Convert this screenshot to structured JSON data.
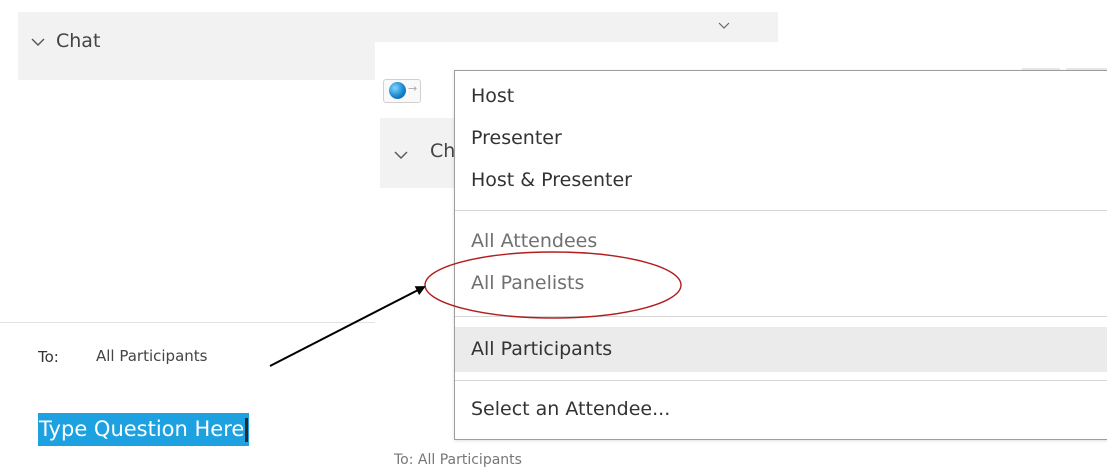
{
  "background_panel": {
    "chat_title": "Chat",
    "to_label": "To:",
    "to_value": "All Participants",
    "question_text": "Type Question Here"
  },
  "overlay_panel": {
    "chat_title_partial": "Ch",
    "bottom_text_partial": "To:   All Participants"
  },
  "dropdown": {
    "groups": [
      [
        "Host",
        "Presenter",
        "Host & Presenter"
      ],
      [
        "All Attendees",
        "All Panelists"
      ],
      [
        "All Participants"
      ],
      [
        "Select an Attendee..."
      ]
    ],
    "selected": "All Participants",
    "circled": "All Panelists"
  },
  "icons": [
    "chevron-down-icon",
    "close-icon",
    "globe-icon",
    "arrow-right-icon"
  ],
  "colors": {
    "selection_highlight": "#1ea1e0",
    "annotation_ellipse": "#b21e1e",
    "annotation_arrow": "#000000",
    "selected_item_bg": "#ebebeb",
    "header_bg": "#f2f2f2"
  }
}
